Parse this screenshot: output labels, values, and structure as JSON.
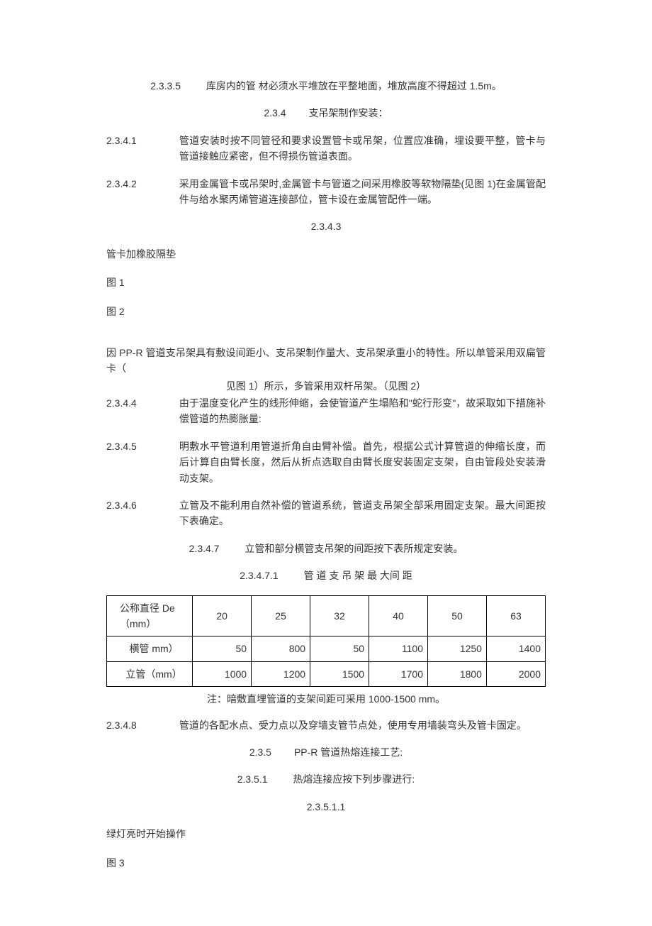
{
  "p1": {
    "num": "2.3.3.5",
    "text": "库房内的管  材必须水平堆放在平整地面，堆放高度不得超过 1.5m。"
  },
  "p2": {
    "num": "2.3.4",
    "text": "支吊架制作安装："
  },
  "p3": {
    "num": "2.3.4.1",
    "text": "管道安装时按不同管径和要求设置管卡或吊架，位置应准确，埋设要平整，管卡与管道接触应紧密，但不得损伤管道表面。"
  },
  "p4": {
    "num": "2.3.4.2",
    "text": "采用金属管卡或吊架时,金属管卡与管道之间采用橡胶等软物隔垫(见图 1)在金属管配件与给水聚丙烯管道连接部位，管卡设在金属管配件一端。"
  },
  "p5": {
    "num": "2.3.4.3"
  },
  "p6": {
    "text": "管卡加橡胶隔垫"
  },
  "p7": {
    "text": "图  1"
  },
  "p8": {
    "text": "图  2"
  },
  "p9": {
    "text1": "因 PP-R 管道支吊架具有敷设间距小、支吊架制作量大、支吊架承重小的特性。所以单管采用双扁管卡（",
    "text2": "见图 1）所示，多管采用双杆吊架。（见图 2）"
  },
  "p10": {
    "num": "2.3.4.4",
    "text": "由于温度变化产生的线形伸缩，会使管道产生塌陷和\"蛇行形变\"，故采取如下措施补偿管道的热膨胀量:"
  },
  "p11": {
    "num": "2.3.4.5",
    "text": "明敷水平管道利用管道折角自由臂补偿。首先，根据公式计算管道的伸缩长度，而后计算自由臂长度，然后从折点选取自由臂长度安装固定支架，自由管段处安装滑动支架。"
  },
  "p12": {
    "num": "2.3.4.6",
    "text": "立管及不能利用自然补偿的管道系统，管道支吊架全部采用固定支架。最大间距按下表确定。"
  },
  "p13": {
    "num": "2.3.4.7",
    "text": "立管和部分横管支吊架的间距按下表所规定安装。"
  },
  "p14": {
    "num": "2.3.4.7.1",
    "text": "管 道 支 吊 架 最 大间 距"
  },
  "table": {
    "rows": [
      {
        "h": "公称直径 De（mm）",
        "v": [
          "20",
          "25",
          "32",
          "40",
          "50",
          "63"
        ]
      },
      {
        "h": "横管 mm）",
        "v": [
          "50",
          "800",
          "50",
          "1100",
          "1250",
          "1400"
        ]
      },
      {
        "h": "立管（mm）",
        "v": [
          "1000",
          "1200",
          "1500",
          "1700",
          "1800",
          "2000"
        ]
      }
    ],
    "note": "注：暗敷直埋管道的支架间距可采用 1000-1500 mm。"
  },
  "p15": {
    "num": "2.3.4.8",
    "text": "管道的各配水点、受力点以及穿墙支管节点处，使用专用墙装弯头及管卡固定。"
  },
  "p16": {
    "num": "2.3.5",
    "text": "PP-R 管道热熔连接工艺:"
  },
  "p17": {
    "num": "2.3.5.1",
    "text": "热熔连接应按下列步骤进行:"
  },
  "p18": {
    "num": "2.3.5.1.1"
  },
  "p19": {
    "text": "绿灯亮时开始操作"
  },
  "p20": {
    "text": "图  3"
  },
  "chart_data": {
    "type": "table",
    "title": "管道支吊架最大间距",
    "columns": [
      "公称直径 De（mm）",
      "20",
      "25",
      "32",
      "40",
      "50",
      "63"
    ],
    "rows": [
      [
        "横管 mm）",
        "50",
        "800",
        "50",
        "1100",
        "1250",
        "1400"
      ],
      [
        "立管（mm）",
        "1000",
        "1200",
        "1500",
        "1700",
        "1800",
        "2000"
      ]
    ],
    "note": "暗敷直埋管道的支架间距可采用 1000-1500 mm"
  }
}
